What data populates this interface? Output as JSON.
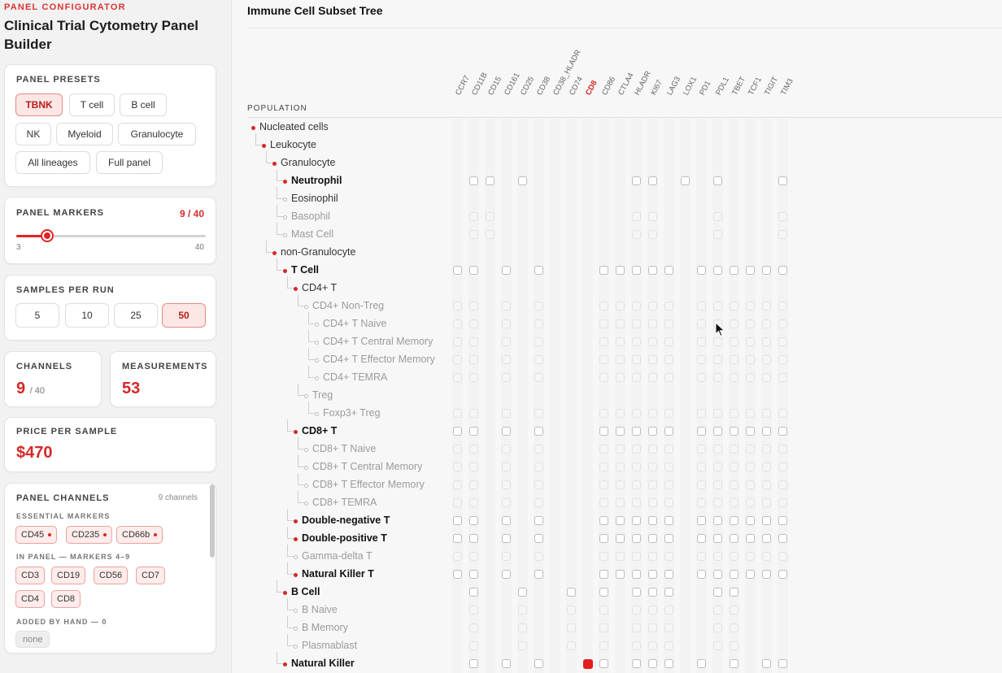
{
  "header": {
    "kicker": "PANEL CONFIGURATOR",
    "title": "Clinical Trial Cytometry Panel Builder"
  },
  "presets": {
    "title": "PANEL PRESETS",
    "items": [
      "TBNK",
      "T cell",
      "B cell",
      "NK",
      "Myeloid",
      "Granulocyte",
      "All lineages",
      "Full panel"
    ],
    "active": "TBNK"
  },
  "markers": {
    "title": "PANEL MARKERS",
    "value_text": "9 / 40",
    "min_label": "3",
    "max_label": "40",
    "value": 9,
    "min": 3,
    "max": 40
  },
  "samples": {
    "title": "SAMPLES PER RUN",
    "options": [
      "5",
      "10",
      "25",
      "50"
    ],
    "active": "50"
  },
  "channels": {
    "title": "CHANNELS",
    "value": "9",
    "sub": "/ 40"
  },
  "measurements": {
    "title": "MEASUREMENTS",
    "value": "53"
  },
  "price": {
    "title": "PRICE PER SAMPLE",
    "value": "$470"
  },
  "panel_channels": {
    "title": "PANEL CHANNELS",
    "count": "9 channels",
    "essential_label": "ESSENTIAL MARKERS",
    "essential": [
      "CD45",
      "CD235",
      "CD66b"
    ],
    "in_panel_label": "IN PANEL — MARKERS 4–9",
    "in_panel": [
      "CD3",
      "CD19",
      "CD56",
      "CD7",
      "CD4",
      "CD8"
    ],
    "added_label": "ADDED BY HAND — 0",
    "added_none": "none"
  },
  "tree": {
    "title": "Immune Cell Subset Tree",
    "population_header": "POPULATION",
    "columns": [
      "CCR7",
      "CD11B",
      "CD15",
      "CD161",
      "CD25",
      "CD38",
      "CD38_HLADR",
      "CD74",
      "CD8",
      "CD86",
      "CTLA4",
      "HLADR",
      "KI67",
      "LAG3",
      "LOX1",
      "PD1",
      "PDL1",
      "TBET",
      "TCF1",
      "TIGIT",
      "TIM3"
    ],
    "selected_column": "CD8",
    "rows": [
      {
        "label": "Nucleated cells",
        "depth": 0,
        "style": "normal",
        "bullet": "filled",
        "cells": []
      },
      {
        "label": "Leukocyte",
        "depth": 1,
        "style": "normal",
        "bullet": "filled",
        "cells": []
      },
      {
        "label": "Granulocyte",
        "depth": 2,
        "style": "normal",
        "bullet": "filled",
        "cells": []
      },
      {
        "label": "Neutrophil",
        "depth": 3,
        "style": "bold",
        "bullet": "filled",
        "cells": [
          1,
          2,
          4,
          11,
          12,
          14,
          16,
          20
        ]
      },
      {
        "label": "Eosinophil",
        "depth": 3,
        "style": "normal",
        "bullet": "hollow",
        "cells": []
      },
      {
        "label": "Basophil",
        "depth": 3,
        "style": "dim",
        "bullet": "hollow",
        "cells": [
          1,
          2,
          11,
          12,
          16,
          20
        ],
        "faint": true
      },
      {
        "label": "Mast Cell",
        "depth": 3,
        "style": "dim",
        "bullet": "hollow",
        "cells": [
          1,
          2,
          11,
          12,
          16,
          20
        ],
        "faint": true
      },
      {
        "label": "non-Granulocyte",
        "depth": 2,
        "style": "normal",
        "bullet": "filled",
        "cells": []
      },
      {
        "label": "T Cell",
        "depth": 3,
        "style": "bold",
        "bullet": "filled",
        "cells": [
          0,
          1,
          3,
          5,
          9,
          10,
          11,
          12,
          13,
          15,
          16,
          17,
          18,
          19,
          20
        ]
      },
      {
        "label": "CD4+ T",
        "depth": 4,
        "style": "normal",
        "bullet": "filled",
        "cells": []
      },
      {
        "label": "CD4+ Non-Treg",
        "depth": 5,
        "style": "dim",
        "bullet": "hollow",
        "cells": [
          0,
          1,
          3,
          5,
          9,
          10,
          11,
          12,
          13,
          15,
          16,
          17,
          18,
          19,
          20
        ],
        "faint": true
      },
      {
        "label": "CD4+ T Naive",
        "depth": 6,
        "style": "dim",
        "bullet": "hollow",
        "cells": [
          0,
          1,
          3,
          5,
          9,
          10,
          11,
          12,
          13,
          15,
          16,
          17,
          18,
          19,
          20
        ],
        "faint": true
      },
      {
        "label": "CD4+ T Central Memory",
        "depth": 6,
        "style": "dim",
        "bullet": "hollow",
        "cells": [
          0,
          1,
          3,
          5,
          9,
          10,
          11,
          12,
          13,
          15,
          16,
          17,
          18,
          19,
          20
        ],
        "faint": true
      },
      {
        "label": "CD4+ T Effector Memory",
        "depth": 6,
        "style": "dim",
        "bullet": "hollow",
        "cells": [
          0,
          1,
          3,
          5,
          9,
          10,
          11,
          12,
          13,
          15,
          16,
          17,
          18,
          19,
          20
        ],
        "faint": true
      },
      {
        "label": "CD4+ TEMRA",
        "depth": 6,
        "style": "dim",
        "bullet": "hollow",
        "cells": [
          0,
          1,
          3,
          5,
          9,
          10,
          11,
          12,
          13,
          15,
          16,
          17,
          18,
          19,
          20
        ],
        "faint": true
      },
      {
        "label": "Treg",
        "depth": 5,
        "style": "dim",
        "bullet": "hollow",
        "cells": []
      },
      {
        "label": "Foxp3+ Treg",
        "depth": 6,
        "style": "dim",
        "bullet": "hollow",
        "cells": [
          0,
          1,
          3,
          5,
          9,
          10,
          11,
          12,
          13,
          15,
          16,
          17,
          18,
          19,
          20
        ],
        "faint": true
      },
      {
        "label": "CD8+ T",
        "depth": 4,
        "style": "bold",
        "bullet": "filled",
        "cells": [
          0,
          1,
          3,
          5,
          9,
          10,
          11,
          12,
          13,
          15,
          16,
          17,
          18,
          19,
          20
        ]
      },
      {
        "label": "CD8+ T Naive",
        "depth": 5,
        "style": "dim",
        "bullet": "hollow",
        "cells": [
          0,
          1,
          3,
          5,
          9,
          10,
          11,
          12,
          13,
          15,
          16,
          17,
          18,
          19,
          20
        ],
        "faint": true
      },
      {
        "label": "CD8+ T Central Memory",
        "depth": 5,
        "style": "dim",
        "bullet": "hollow",
        "cells": [
          0,
          1,
          3,
          5,
          9,
          10,
          11,
          12,
          13,
          15,
          16,
          17,
          18,
          19,
          20
        ],
        "faint": true
      },
      {
        "label": "CD8+ T Effector Memory",
        "depth": 5,
        "style": "dim",
        "bullet": "hollow",
        "cells": [
          0,
          1,
          3,
          5,
          9,
          10,
          11,
          12,
          13,
          15,
          16,
          17,
          18,
          19,
          20
        ],
        "faint": true
      },
      {
        "label": "CD8+ TEMRA",
        "depth": 5,
        "style": "dim",
        "bullet": "hollow",
        "cells": [
          0,
          1,
          3,
          5,
          9,
          10,
          11,
          12,
          13,
          15,
          16,
          17,
          18,
          19,
          20
        ],
        "faint": true
      },
      {
        "label": "Double-negative T",
        "depth": 4,
        "style": "bold",
        "bullet": "filled",
        "cells": [
          0,
          1,
          3,
          5,
          9,
          10,
          11,
          12,
          13,
          15,
          16,
          17,
          18,
          19,
          20
        ]
      },
      {
        "label": "Double-positive T",
        "depth": 4,
        "style": "bold",
        "bullet": "filled",
        "cells": [
          0,
          1,
          3,
          5,
          9,
          10,
          11,
          12,
          13,
          15,
          16,
          17,
          18,
          19,
          20
        ]
      },
      {
        "label": "Gamma-delta T",
        "depth": 4,
        "style": "dim",
        "bullet": "hollow",
        "cells": [
          0,
          1,
          3,
          5,
          9,
          10,
          11,
          12,
          13,
          15,
          16,
          17,
          18,
          19,
          20
        ],
        "faint": true
      },
      {
        "label": "Natural Killer T",
        "depth": 4,
        "style": "bold",
        "bullet": "filled",
        "cells": [
          0,
          1,
          3,
          5,
          9,
          10,
          11,
          12,
          13,
          15,
          16,
          17,
          18,
          19,
          20
        ]
      },
      {
        "label": "B Cell",
        "depth": 3,
        "style": "bold",
        "bullet": "filled",
        "cells": [
          1,
          4,
          7,
          9,
          11,
          12,
          13,
          16,
          17
        ]
      },
      {
        "label": "B Naive",
        "depth": 4,
        "style": "dim",
        "bullet": "hollow",
        "cells": [
          1,
          4,
          7,
          9,
          11,
          12,
          13,
          16,
          17
        ],
        "faint": true
      },
      {
        "label": "B Memory",
        "depth": 4,
        "style": "dim",
        "bullet": "hollow",
        "cells": [
          1,
          4,
          7,
          9,
          11,
          12,
          13,
          16,
          17
        ],
        "faint": true
      },
      {
        "label": "Plasmablast",
        "depth": 4,
        "style": "dim",
        "bullet": "hollow",
        "cells": [
          1,
          4,
          7,
          9,
          11,
          12,
          13,
          16,
          17
        ],
        "faint": true
      },
      {
        "label": "Natural Killer",
        "depth": 3,
        "style": "bold",
        "bullet": "filled",
        "cells": [
          1,
          3,
          5,
          8,
          9,
          11,
          12,
          13,
          15,
          17,
          19,
          20
        ],
        "on": [
          8
        ]
      }
    ]
  },
  "colors": {
    "accent": "#d62828",
    "accent_bg": "#fde7e5"
  }
}
